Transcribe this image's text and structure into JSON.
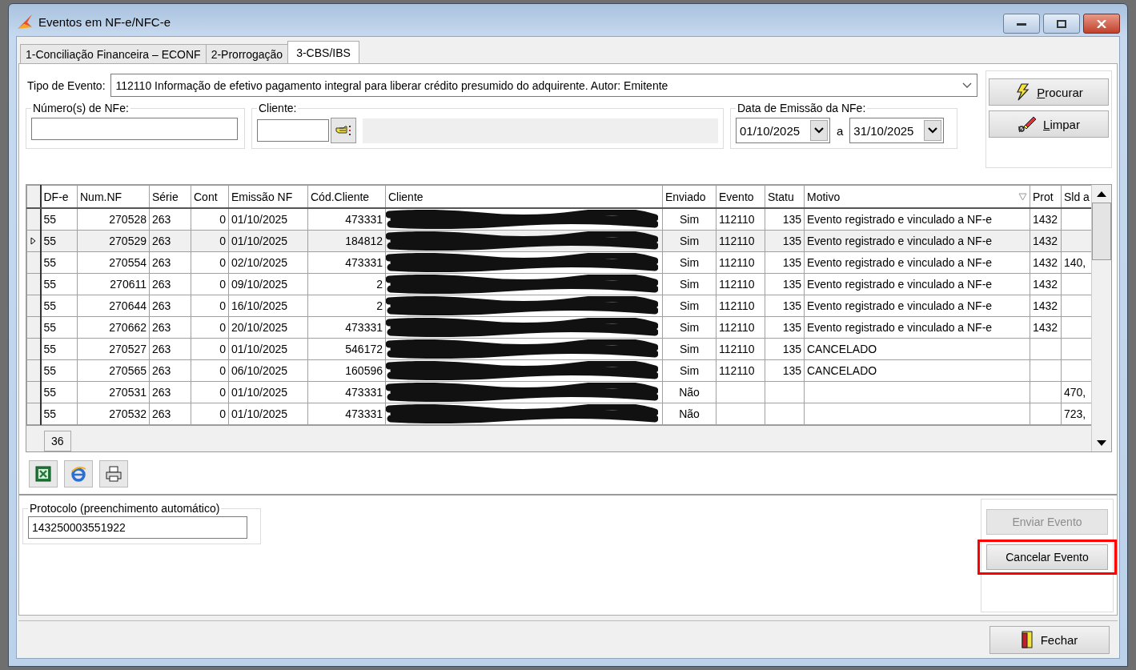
{
  "window": {
    "title": "Eventos em NF-e/NFC-e"
  },
  "tabs": [
    {
      "label": "1-Conciliação Financeira – ECONF",
      "selected": false
    },
    {
      "label": "2-Prorrogação",
      "selected": false
    },
    {
      "label": "3-CBS/IBS",
      "selected": true
    }
  ],
  "filters": {
    "event_type": {
      "label": "Tipo de Evento:",
      "value": "112110 Informação de efetivo pagamento integral para liberar crédito presumido do adquirente. Autor: Emitente"
    },
    "nfe_numbers": {
      "label": "Número(s) de NFe:"
    },
    "client": {
      "label": "Cliente:"
    },
    "date_range": {
      "label": "Data de Emissão da NFe:",
      "from": "01/10/2025",
      "separator": "a",
      "to": "31/10/2025"
    }
  },
  "search_buttons": [
    {
      "label": "Procurar",
      "kind": "search"
    },
    {
      "label": "Limpar",
      "kind": "clear"
    }
  ],
  "grid": {
    "columns": [
      {
        "label": "DF-e",
        "kind": "text",
        "filterable": false
      },
      {
        "label": "Num.NF",
        "kind": "text",
        "filterable": false
      },
      {
        "label": "Série",
        "kind": "text",
        "filterable": false
      },
      {
        "label": "Cont",
        "kind": "text",
        "filterable": false
      },
      {
        "label": "Emissão NF",
        "kind": "text",
        "filterable": false
      },
      {
        "label": "Cód.Cliente",
        "kind": "text",
        "filterable": false
      },
      {
        "label": "Cliente",
        "kind": "redacted",
        "filterable": false
      },
      {
        "label": "Enviado",
        "kind": "text",
        "filterable": false
      },
      {
        "label": "Evento",
        "kind": "text",
        "filterable": false
      },
      {
        "label": "Statu",
        "kind": "text",
        "filterable": false
      },
      {
        "label": "Motivo",
        "kind": "text",
        "filterable": true
      },
      {
        "label": "Prot",
        "kind": "text",
        "filterable": false
      },
      {
        "label": "Sld a",
        "kind": "text",
        "filterable": false
      }
    ],
    "rows": [
      {
        "selected": false,
        "df_e": "55",
        "num_nf": "270528",
        "serie": "263",
        "conta": "0",
        "emissao": "01/10/2025",
        "cod_cliente": "473331",
        "enviado": "Sim",
        "evento": "112110",
        "status": "135",
        "motivo": "Evento registrado e vinculado a NF-e",
        "proto": "1432"
      },
      {
        "selected": true,
        "df_e": "55",
        "num_nf": "270529",
        "serie": "263",
        "conta": "0",
        "emissao": "01/10/2025",
        "cod_cliente": "184812",
        "enviado": "Sim",
        "evento": "112110",
        "status": "135",
        "motivo": "Evento registrado e vinculado a NF-e",
        "proto": "1432"
      },
      {
        "selected": false,
        "df_e": "55",
        "num_nf": "270554",
        "serie": "263",
        "conta": "0",
        "emissao": "02/10/2025",
        "cod_cliente": "473331",
        "enviado": "Sim",
        "evento": "112110",
        "status": "135",
        "motivo": "Evento registrado e vinculado a NF-e",
        "proto": "1432",
        "sld": "140,"
      },
      {
        "selected": false,
        "df_e": "55",
        "num_nf": "270611",
        "serie": "263",
        "conta": "0",
        "emissao": "09/10/2025",
        "cod_cliente": "2",
        "enviado": "Sim",
        "evento": "112110",
        "status": "135",
        "motivo": "Evento registrado e vinculado a NF-e",
        "proto": "1432"
      },
      {
        "selected": false,
        "df_e": "55",
        "num_nf": "270644",
        "serie": "263",
        "conta": "0",
        "emissao": "16/10/2025",
        "cod_cliente": "2",
        "enviado": "Sim",
        "evento": "112110",
        "status": "135",
        "motivo": "Evento registrado e vinculado a NF-e",
        "proto": "1432"
      },
      {
        "selected": false,
        "df_e": "55",
        "num_nf": "270662",
        "serie": "263",
        "conta": "0",
        "emissao": "20/10/2025",
        "cod_cliente": "473331",
        "enviado": "Sim",
        "evento": "112110",
        "status": "135",
        "motivo": "Evento registrado e vinculado a NF-e",
        "proto": "1432"
      },
      {
        "selected": false,
        "df_e": "55",
        "num_nf": "270527",
        "serie": "263",
        "conta": "0",
        "emissao": "01/10/2025",
        "cod_cliente": "546172",
        "enviado": "Sim",
        "evento": "112110",
        "status": "135",
        "motivo": "CANCELADO"
      },
      {
        "selected": false,
        "df_e": "55",
        "num_nf": "270565",
        "serie": "263",
        "conta": "0",
        "emissao": "06/10/2025",
        "cod_cliente": "160596",
        "enviado": "Sim",
        "evento": "112110",
        "status": "135",
        "motivo": "CANCELADO"
      },
      {
        "selected": false,
        "df_e": "55",
        "num_nf": "270531",
        "serie": "263",
        "conta": "0",
        "emissao": "01/10/2025",
        "cod_cliente": "473331",
        "enviado": "Não",
        "sld": "470,"
      },
      {
        "selected": false,
        "df_e": "55",
        "num_nf": "270532",
        "serie": "263",
        "conta": "0",
        "emissao": "01/10/2025",
        "cod_cliente": "473331",
        "enviado": "Não",
        "sld": "723,"
      }
    ],
    "record_count": "36"
  },
  "protocol": {
    "label": "Protocolo (preenchimento automático)",
    "value": "143250003551922"
  },
  "action_buttons": [
    {
      "label": "Enviar Evento",
      "disabled": true,
      "highlighted": false
    },
    {
      "label": "Cancelar Evento",
      "disabled": false,
      "highlighted": true
    }
  ],
  "close_button": {
    "label": "Fechar"
  }
}
